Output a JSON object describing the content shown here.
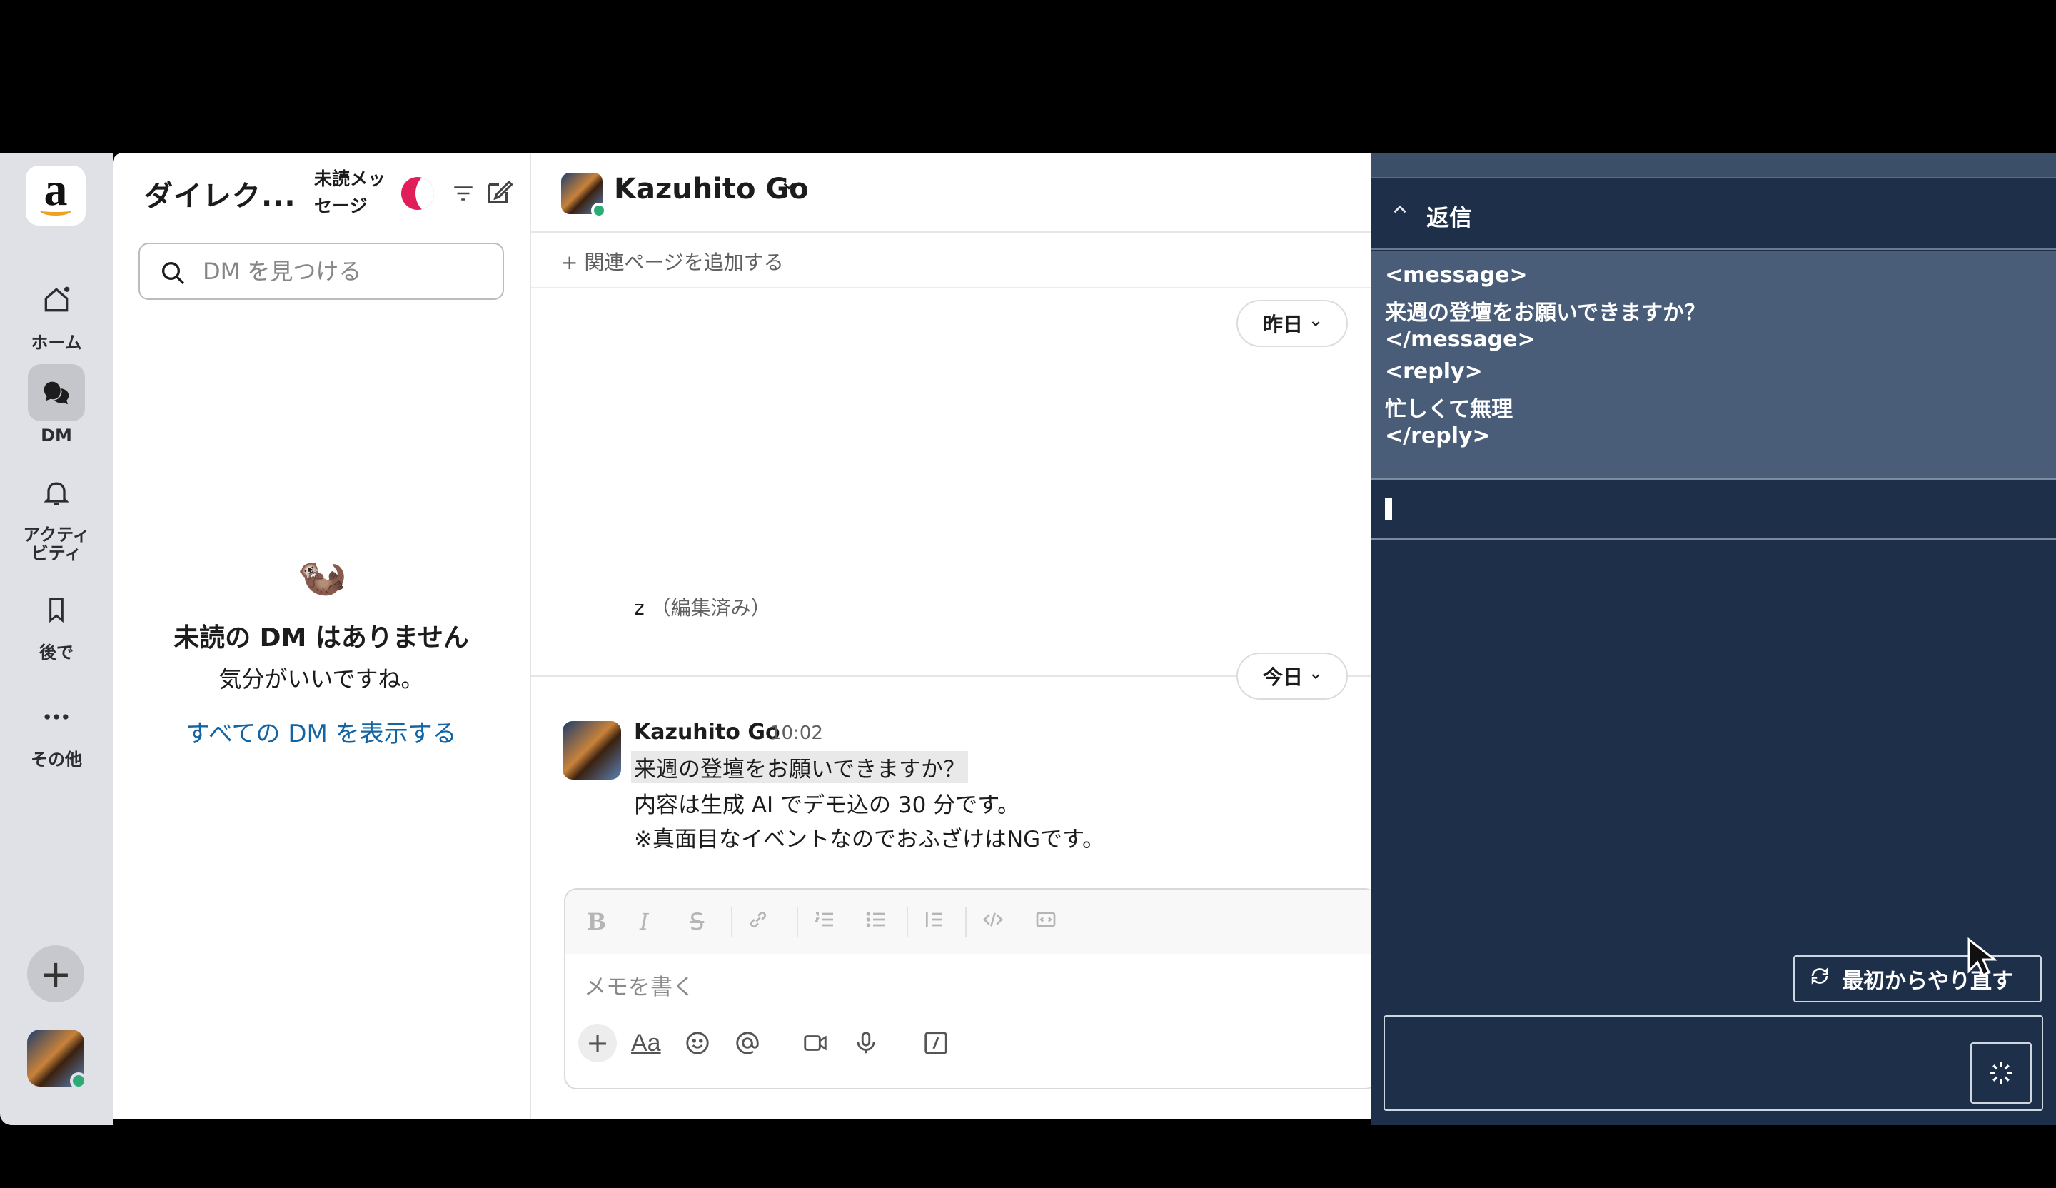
{
  "rail": {
    "items": [
      {
        "label": "ホーム",
        "icon": "home-icon"
      },
      {
        "label": "DM",
        "icon": "dm-icon"
      },
      {
        "label": "アクティ\nビティ",
        "icon": "bell-icon"
      },
      {
        "label": "後で",
        "icon": "bookmark-icon"
      },
      {
        "label": "その他",
        "icon": "more-icon"
      }
    ],
    "add_symbol": "+"
  },
  "dm_panel": {
    "title": "ダイレク...",
    "unread_label": "未読メッセージ",
    "search_placeholder": "DM を見つける",
    "empty_emoji": "🦦",
    "empty_title": "未読の DM はありません",
    "empty_sub": "気分がいいですね。",
    "show_all_link": "すべての DM を表示する"
  },
  "conversation": {
    "name": "Kazuhito Go",
    "add_bookmark": "+ 関連ページを追加する",
    "date_yesterday": "昨日",
    "date_today": "今日",
    "edited_message": "z",
    "edited_tag": "（編集済み）",
    "message": {
      "author": "Kazuhito Go",
      "time": "10:02",
      "lines": [
        "来週の登壇をお願いできますか？",
        "内容は生成 AI でデモ込の 30 分です。",
        "※真面目なイベントなのでおふざけはNGです。"
      ]
    },
    "composer_placeholder": "メモを書く"
  },
  "side_panel": {
    "section_title": "返信",
    "block_lines": [
      "<message>",
      "来週の登壇をお願いできますか？",
      "</message>",
      "<reply>",
      "忙しくて無理",
      "</reply>"
    ],
    "restart_label": "最初からやり直す",
    "input_value": ""
  },
  "colors": {
    "rail_bg": "#dfe1e6",
    "side_bg": "#1e3049",
    "side_block_bg": "#4a5d78",
    "link": "#1264a3",
    "presence": "#2bac76",
    "accent": "#e01e5a"
  }
}
